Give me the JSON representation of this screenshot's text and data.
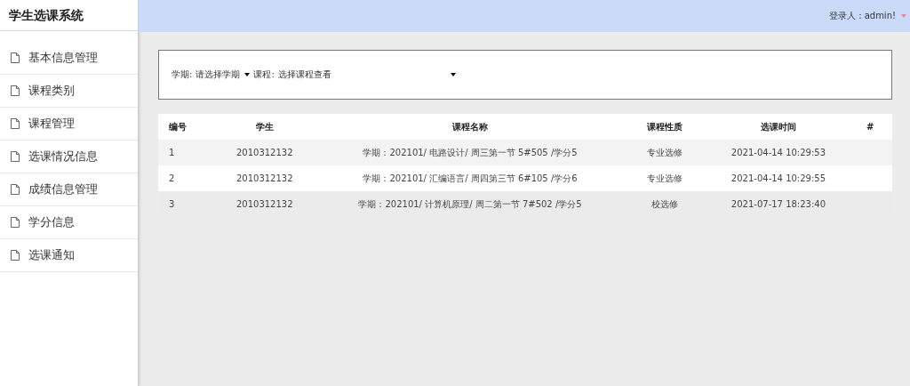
{
  "sidebar": {
    "title": "学生选课系统",
    "items": [
      {
        "label": "基本信息管理"
      },
      {
        "label": "课程类别"
      },
      {
        "label": "课程管理"
      },
      {
        "label": "选课情况信息"
      },
      {
        "label": "成绩信息管理"
      },
      {
        "label": "学分信息"
      },
      {
        "label": "选课通知"
      }
    ]
  },
  "header": {
    "user": "登录人：admin!"
  },
  "filters": [
    {
      "label": "学期:",
      "value": "请选择学期"
    },
    {
      "label": "课程:",
      "value": "选择课程查看"
    }
  ],
  "table": {
    "columns": [
      "编号",
      "学生",
      "课程名称",
      "课程性质",
      "选课时间",
      "#"
    ],
    "rows": [
      [
        "1",
        "2010312132",
        "学期：202101/ 电路设计/ 周三第一节 5#505 /学分5",
        "专业选修",
        "2021-04-14 10:29:53",
        ""
      ],
      [
        "2",
        "2010312132",
        "学期：202101/ 汇编语言/ 周四第三节 6#105 /学分6",
        "专业选修",
        "2021-04-14 10:29:55",
        ""
      ],
      [
        "3",
        "2010312132",
        "学期：202101/ 计算机原理/ 周二第一节 7#502 /学分5",
        "校选修",
        "2021-07-17 18:23:40",
        ""
      ]
    ]
  }
}
